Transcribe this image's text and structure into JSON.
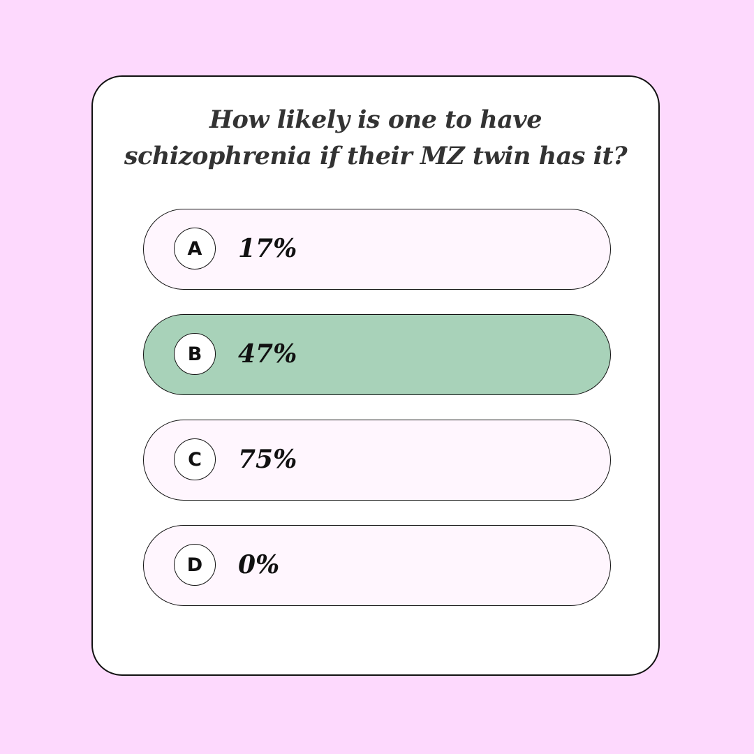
{
  "quiz": {
    "question_line1": "How likely is one to have",
    "question_line2": "schizophrenia if their MZ twin has it?",
    "selected_option": "B",
    "options": [
      {
        "letter": "A",
        "value": "17%"
      },
      {
        "letter": "B",
        "value": "47%"
      },
      {
        "letter": "C",
        "value": "75%"
      },
      {
        "letter": "D",
        "value": "0%"
      }
    ]
  },
  "colors": {
    "background": "#fdd9fd",
    "card": "#ffffff",
    "option_default": "#fff6fe",
    "option_selected": "#a8d2b9",
    "border": "#111111"
  }
}
